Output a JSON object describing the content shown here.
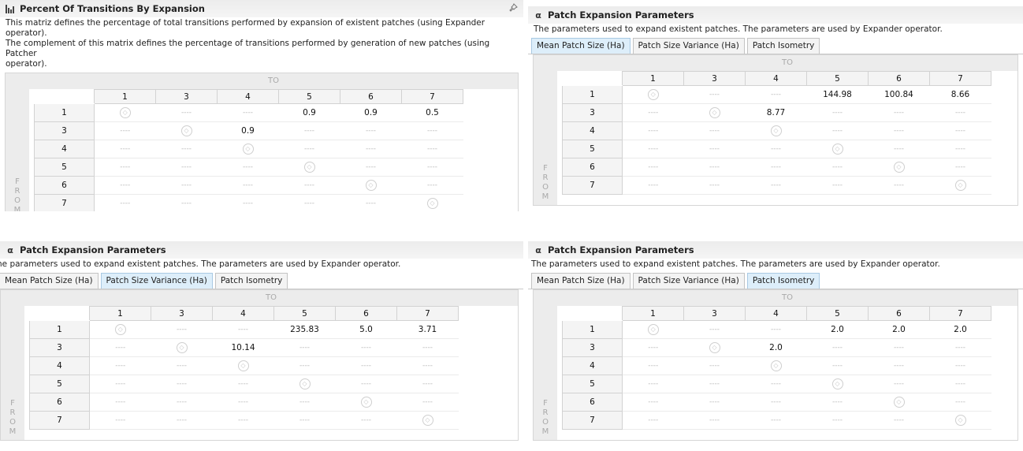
{
  "panels": [
    {
      "id": "p1",
      "title": "Percent Of Transitions By Expansion",
      "icon": "bar-chart-icon",
      "description": [
        "This matriz defines the percentage of total transitions performed by expansion of existent patches (using Expander operator).",
        "The complement of this matrix defines the percentage of transitions performed by generation of new patches (using Patcher",
        "operator)."
      ],
      "tabs": [],
      "to_label": "TO",
      "from_label": [
        "F",
        "R",
        "O",
        "M"
      ],
      "columns": [
        "1",
        "3",
        "4",
        "5",
        "6",
        "7"
      ],
      "rows": [
        {
          "label": "1",
          "cells": [
            "◇",
            "----",
            "----",
            "0.9",
            "0.9",
            "0.5"
          ]
        },
        {
          "label": "3",
          "cells": [
            "----",
            "◇",
            "0.9",
            "----",
            "----",
            "----"
          ]
        },
        {
          "label": "4",
          "cells": [
            "----",
            "----",
            "◇",
            "----",
            "----",
            "----"
          ]
        },
        {
          "label": "5",
          "cells": [
            "----",
            "----",
            "----",
            "◇",
            "----",
            "----"
          ]
        },
        {
          "label": "6",
          "cells": [
            "----",
            "----",
            "----",
            "----",
            "◇",
            "----"
          ]
        },
        {
          "label": "7",
          "cells": [
            "----",
            "----",
            "----",
            "----",
            "----",
            "◇"
          ]
        }
      ]
    },
    {
      "id": "p2",
      "title": "Patch Expansion Parameters",
      "icon": "alpha-icon",
      "description": [
        "The parameters used to expand existent patches. The parameters are used by Expander operator."
      ],
      "tabs": [
        "Mean Patch Size (Ha)",
        "Patch Size Variance (Ha)",
        "Patch Isometry"
      ],
      "active_tab": 0,
      "to_label": "TO",
      "from_label": [
        "F",
        "R",
        "O",
        "M"
      ],
      "columns": [
        "1",
        "3",
        "4",
        "5",
        "6",
        "7"
      ],
      "rows": [
        {
          "label": "1",
          "cells": [
            "◇",
            "----",
            "----",
            "144.98",
            "100.84",
            "8.66"
          ]
        },
        {
          "label": "3",
          "cells": [
            "----",
            "◇",
            "8.77",
            "----",
            "----",
            "----"
          ]
        },
        {
          "label": "4",
          "cells": [
            "----",
            "----",
            "◇",
            "----",
            "----",
            "----"
          ]
        },
        {
          "label": "5",
          "cells": [
            "----",
            "----",
            "----",
            "◇",
            "----",
            "----"
          ]
        },
        {
          "label": "6",
          "cells": [
            "----",
            "----",
            "----",
            "----",
            "◇",
            "----"
          ]
        },
        {
          "label": "7",
          "cells": [
            "----",
            "----",
            "----",
            "----",
            "----",
            "◇"
          ]
        }
      ]
    },
    {
      "id": "p3",
      "title": "Patch Expansion Parameters",
      "icon": "alpha-icon",
      "description": [
        "he parameters used to expand existent patches. The parameters are used by Expander operator."
      ],
      "tabs": [
        "Mean Patch Size (Ha)",
        "Patch Size Variance (Ha)",
        "Patch Isometry"
      ],
      "active_tab": 1,
      "to_label": "TO",
      "from_label": [
        "F",
        "R",
        "O",
        "M"
      ],
      "columns": [
        "1",
        "3",
        "4",
        "5",
        "6",
        "7"
      ],
      "rows": [
        {
          "label": "1",
          "cells": [
            "◇",
            "----",
            "----",
            "235.83",
            "5.0",
            "3.71"
          ]
        },
        {
          "label": "3",
          "cells": [
            "----",
            "◇",
            "10.14",
            "----",
            "----",
            "----"
          ]
        },
        {
          "label": "4",
          "cells": [
            "----",
            "----",
            "◇",
            "----",
            "----",
            "----"
          ]
        },
        {
          "label": "5",
          "cells": [
            "----",
            "----",
            "----",
            "◇",
            "----",
            "----"
          ]
        },
        {
          "label": "6",
          "cells": [
            "----",
            "----",
            "----",
            "----",
            "◇",
            "----"
          ]
        },
        {
          "label": "7",
          "cells": [
            "----",
            "----",
            "----",
            "----",
            "----",
            "◇"
          ]
        }
      ]
    },
    {
      "id": "p4",
      "title": "Patch Expansion Parameters",
      "icon": "alpha-icon",
      "description": [
        "The parameters used to expand existent patches. The parameters are used by Expander operator."
      ],
      "tabs": [
        "Mean Patch Size (Ha)",
        "Patch Size Variance (Ha)",
        "Patch Isometry"
      ],
      "active_tab": 2,
      "to_label": "TO",
      "from_label": [
        "F",
        "R",
        "O",
        "M"
      ],
      "columns": [
        "1",
        "3",
        "4",
        "5",
        "6",
        "7"
      ],
      "rows": [
        {
          "label": "1",
          "cells": [
            "◇",
            "----",
            "----",
            "2.0",
            "2.0",
            "2.0"
          ]
        },
        {
          "label": "3",
          "cells": [
            "----",
            "◇",
            "2.0",
            "----",
            "----",
            "----"
          ]
        },
        {
          "label": "4",
          "cells": [
            "----",
            "----",
            "◇",
            "----",
            "----",
            "----"
          ]
        },
        {
          "label": "5",
          "cells": [
            "----",
            "----",
            "----",
            "◇",
            "----",
            "----"
          ]
        },
        {
          "label": "6",
          "cells": [
            "----",
            "----",
            "----",
            "----",
            "◇",
            "----"
          ]
        },
        {
          "label": "7",
          "cells": [
            "----",
            "----",
            "----",
            "----",
            "----",
            "◇"
          ]
        }
      ]
    }
  ]
}
